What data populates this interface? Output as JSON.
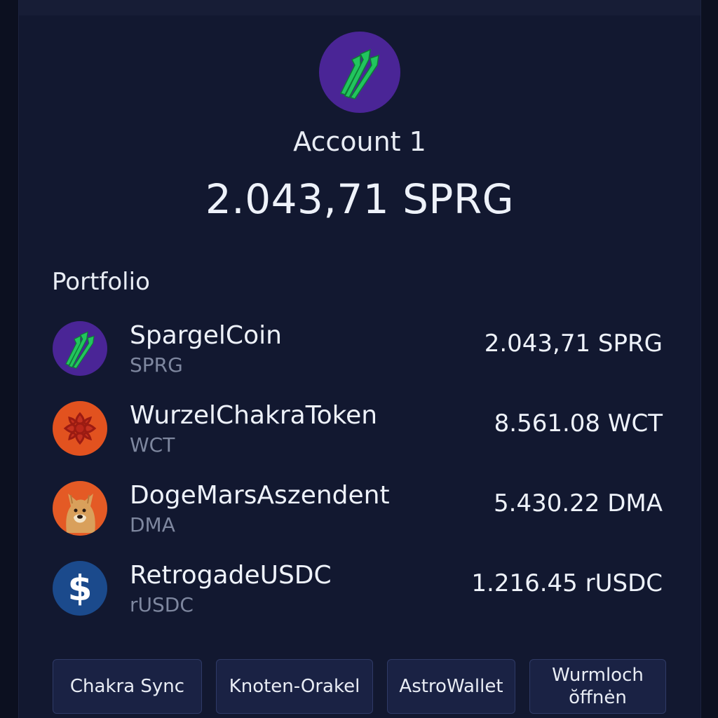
{
  "account": {
    "name": "Account 1",
    "balance": "2.043,71 SPRG",
    "avatar_icon": "asparagus-icon"
  },
  "portfolio": {
    "title": "Portfolio",
    "assets": [
      {
        "name": "SpargelCoin",
        "symbol": "SPRG",
        "amount": "2.043,71 SPRG",
        "icon": "asparagus-icon",
        "icon_bg": "#4a2596"
      },
      {
        "name": "WurzelChakraToken",
        "symbol": "WCT",
        "amount": "8.561.08 WCT",
        "icon": "lotus-icon",
        "icon_bg": "#e2521f"
      },
      {
        "name": "DogeMarsAszendent",
        "symbol": "DMA",
        "amount": "5.430.22 DMA",
        "icon": "doge-icon",
        "icon_bg": "#e45a25"
      },
      {
        "name": "RetrogadeUSDC",
        "symbol": "rUSDC",
        "amount": "1.216.45 rUSDC",
        "icon": "dollar-icon",
        "icon_bg": "#1b4a8c"
      }
    ]
  },
  "actions": [
    {
      "label": "Chakra Sync"
    },
    {
      "label": "Knoten-Orakel"
    },
    {
      "label": "AstroWallet"
    },
    {
      "label": "Wurmloch ŏffnėn"
    }
  ],
  "colors": {
    "background": "#0c1020",
    "panel": "#121830",
    "button": "#1a2244",
    "muted_text": "#7e879f"
  }
}
